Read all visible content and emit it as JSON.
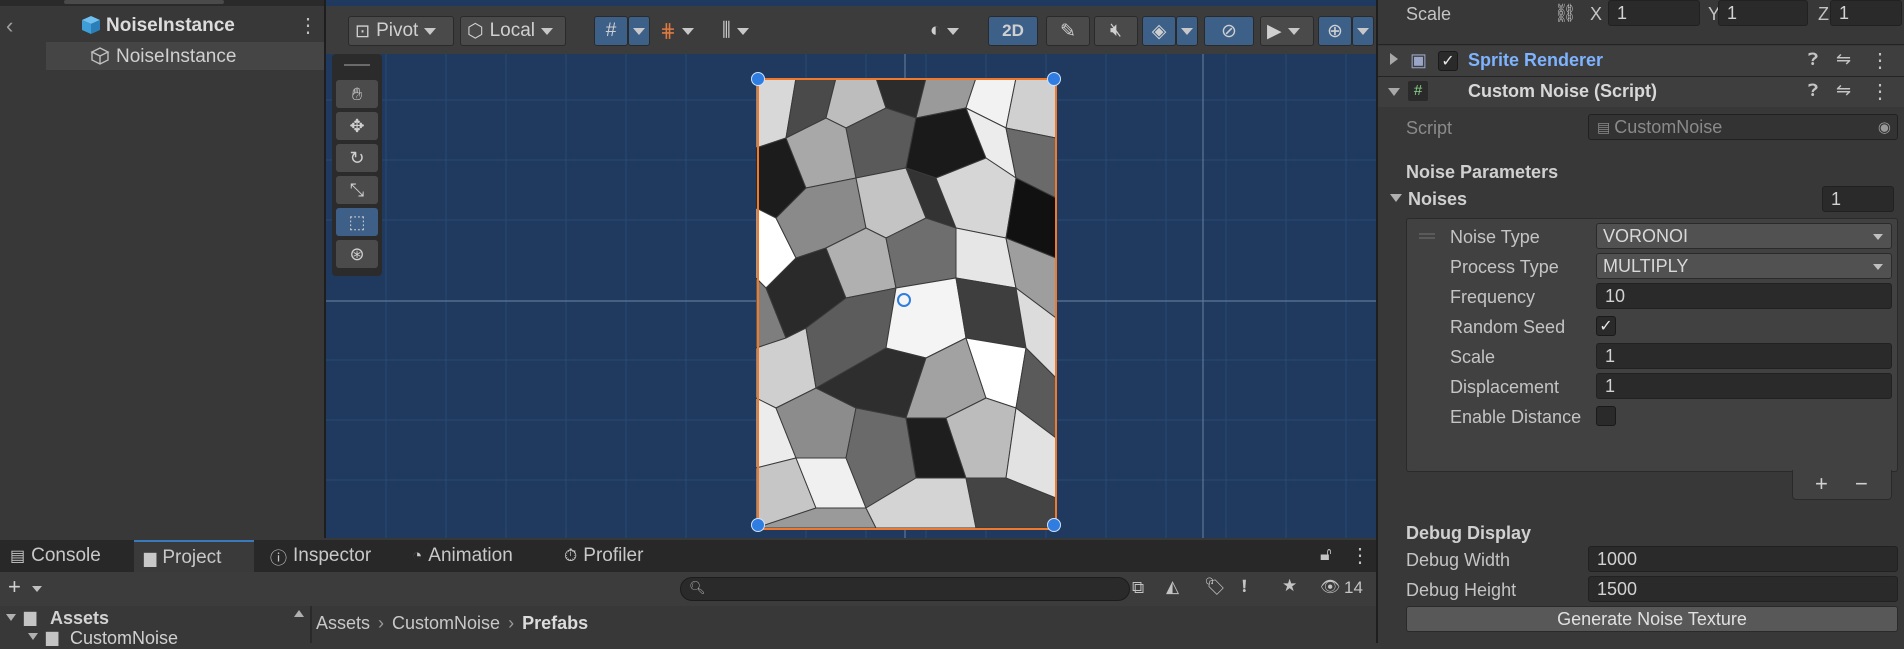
{
  "hierarchy": {
    "root": "NoiseInstance",
    "child": "NoiseInstance"
  },
  "scene": {
    "toolbar": {
      "pivot": "Pivot",
      "local": "Local",
      "mode_2d": "2D"
    }
  },
  "inspector": {
    "scale_label": "Scale",
    "scale_x_label": "X",
    "scale_x": "1",
    "scale_y_label": "Y",
    "scale_y": "1",
    "scale_z_label": "Z",
    "scale_z": "1",
    "sprite_renderer": "Sprite Renderer",
    "custom_noise": "Custom Noise (Script)",
    "script_label": "Script",
    "script_value": "CustomNoise",
    "noise_parameters": "Noise Parameters",
    "noises_label": "Noises",
    "noises_count": "1",
    "element": {
      "noise_type_label": "Noise Type",
      "noise_type": "VORONOI",
      "process_type_label": "Process Type",
      "process_type": "MULTIPLY",
      "frequency_label": "Frequency",
      "frequency": "10",
      "random_seed_label": "Random Seed",
      "random_seed": true,
      "scale_label": "Scale",
      "scale": "1",
      "displacement_label": "Displacement",
      "displacement": "1",
      "enable_distance_label": "Enable Distance",
      "enable_distance": false
    },
    "add_label": "+",
    "remove_label": "−",
    "debug_display": "Debug Display",
    "debug_width_label": "Debug Width",
    "debug_width": "1000",
    "debug_height_label": "Debug Height",
    "debug_height": "1500",
    "generate_button": "Generate Noise Texture"
  },
  "bottom": {
    "tabs": [
      {
        "label": "Console"
      },
      {
        "label": "Project"
      },
      {
        "label": "Inspector"
      },
      {
        "label": "Animation"
      },
      {
        "label": "Profiler"
      }
    ],
    "tree_root": "Assets",
    "tree_child": "CustomNoise",
    "breadcrumb": [
      "Assets",
      "CustomNoise",
      "Prefabs"
    ],
    "visible_count": "14"
  },
  "colors": {
    "accent": "#3a79bb",
    "selection": "#f0792c",
    "scene_bg": "#1f3a5e"
  }
}
